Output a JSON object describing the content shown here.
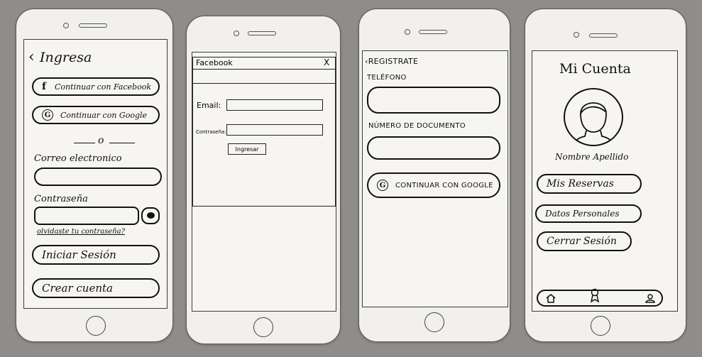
{
  "login": {
    "title": "Ingresa",
    "back_icon": "chevron-left-icon",
    "facebook_button": "Continuar con Facebook",
    "google_button": "Continuar con Google",
    "divider": "o",
    "email_label": "Correo electronico",
    "password_label": "Contraseña",
    "eye_icon": "eye-icon",
    "forgot_link": "olvidaste tu contraseña?",
    "login_button": "Iniciar Sesión",
    "create_button": "Crear cuenta"
  },
  "facebook_dialog": {
    "title": "Facebook",
    "close": "X",
    "email_label": "Email:",
    "password_label": "Contraseña:",
    "submit": "Ingresar"
  },
  "register": {
    "title": "REGISTRATE",
    "phone_label": "TELÉFONO",
    "document_label": "NÚMERO DE DOCUMENTO",
    "google_button": "CONTINUAR CON GOOGLE"
  },
  "account": {
    "title": "Mi Cuenta",
    "name": "Nombre Apellido",
    "reservations_button": "Mis Reservas",
    "personal_button": "Datos Personales",
    "logout_button": "Cerrar Sesión",
    "tab_icons": [
      "home-icon",
      "badge-icon",
      "user-icon"
    ]
  }
}
